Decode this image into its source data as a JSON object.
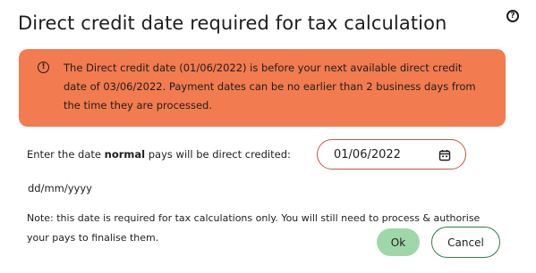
{
  "dialog": {
    "title": "Direct credit date required for tax calculation",
    "help_icon": "question-circle-icon"
  },
  "alert": {
    "icon": "warning-circle-icon",
    "message": "The Direct credit date (01/06/2022) is before your next available direct credit date of 03/06/2022. Payment dates can be no earlier than 2 business days from the time they are processed.",
    "color": "#f27b4f"
  },
  "form": {
    "label_before": "Enter the date ",
    "label_bold": "normal",
    "label_after": " pays will be direct credited:",
    "date_value": "01/06/2022",
    "date_format_hint": "dd/mm/yyyy",
    "calendar_icon": "calendar-icon"
  },
  "note": {
    "text": "Note: this date is required for tax calculations only. You will still need to process & authorise your pays to finalise them."
  },
  "actions": {
    "ok_label": "Ok",
    "cancel_label": "Cancel",
    "ok_color": "#9fd8a8",
    "cancel_border_color": "#2e7d4f"
  }
}
